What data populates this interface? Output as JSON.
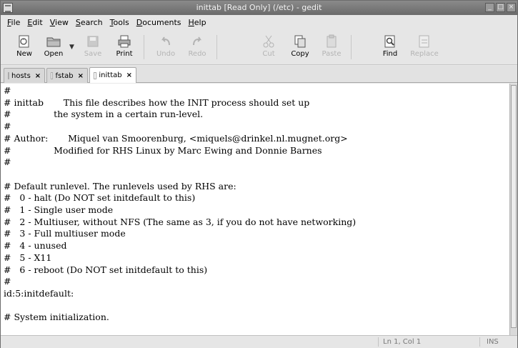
{
  "window": {
    "title": "inittab [Read Only] (/etc) - gedit"
  },
  "menubar": {
    "items": [
      {
        "label": "File",
        "accel": "F",
        "rest": "ile"
      },
      {
        "label": "Edit",
        "accel": "E",
        "rest": "dit"
      },
      {
        "label": "View",
        "accel": "V",
        "rest": "iew"
      },
      {
        "label": "Search",
        "accel": "S",
        "rest": "earch"
      },
      {
        "label": "Tools",
        "accel": "T",
        "rest": "ools"
      },
      {
        "label": "Documents",
        "accel": "D",
        "rest": "ocuments"
      },
      {
        "label": "Help",
        "accel": "H",
        "rest": "elp"
      }
    ]
  },
  "toolbar": {
    "new_label": "New",
    "open_label": "Open",
    "save_label": "Save",
    "print_label": "Print",
    "undo_label": "Undo",
    "redo_label": "Redo",
    "cut_label": "Cut",
    "copy_label": "Copy",
    "paste_label": "Paste",
    "find_label": "Find",
    "replace_label": "Replace"
  },
  "tabs": [
    {
      "label": "hosts",
      "close": "×"
    },
    {
      "label": "fstab",
      "close": "×"
    },
    {
      "label": "inittab",
      "close": "×"
    }
  ],
  "editor": {
    "text": "#\n# inittab       This file describes how the INIT process should set up\n#               the system in a certain run-level.\n#\n# Author:       Miquel van Smoorenburg, <miquels@drinkel.nl.mugnet.org>\n#               Modified for RHS Linux by Marc Ewing and Donnie Barnes\n#\n\n# Default runlevel. The runlevels used by RHS are:\n#   0 - halt (Do NOT set initdefault to this)\n#   1 - Single user mode\n#   2 - Multiuser, without NFS (The same as 3, if you do not have networking)\n#   3 - Full multiuser mode\n#   4 - unused\n#   5 - X11\n#   6 - reboot (Do NOT set initdefault to this)\n#\nid:5:initdefault:\n\n# System initialization."
  },
  "status": {
    "position": "Ln 1, Col 1",
    "mode": "INS"
  }
}
